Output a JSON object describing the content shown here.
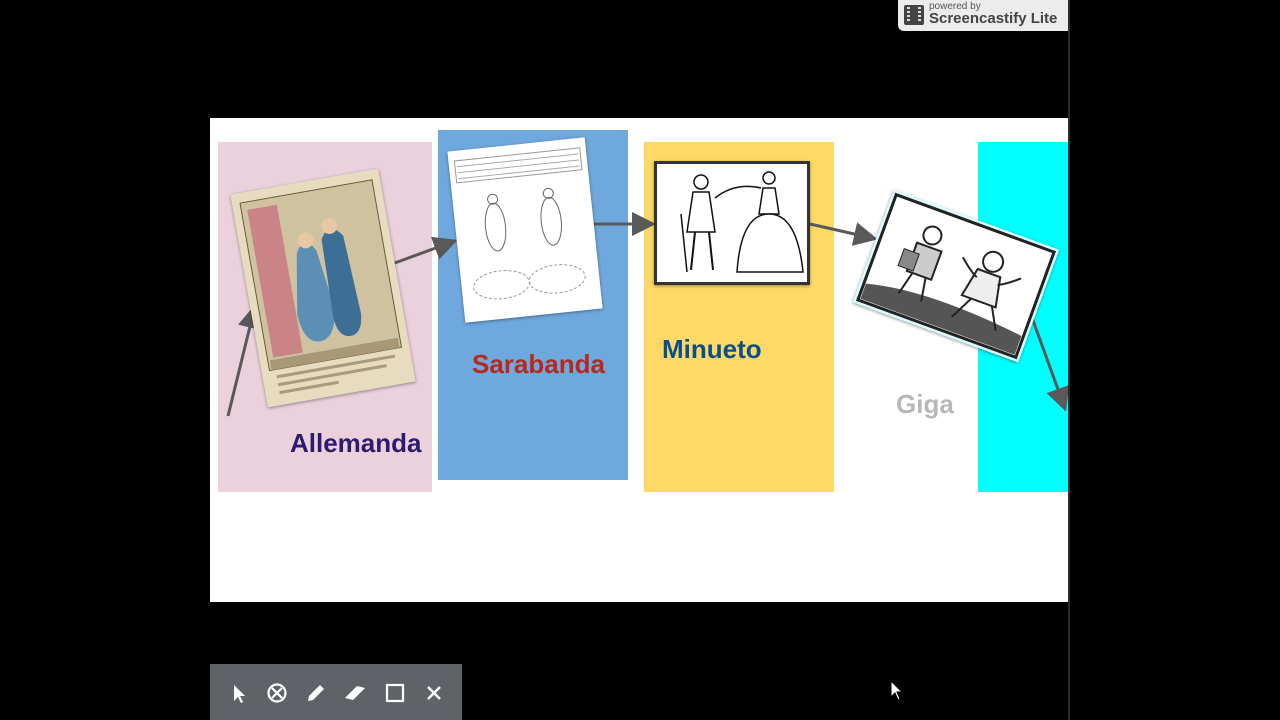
{
  "recorder": {
    "powered_by": "powered by",
    "name": "Screencastify Lite"
  },
  "slide": {
    "dances": [
      {
        "name": "Allemanda",
        "color": "#2e1a6e",
        "panel_color": "#ead1dc"
      },
      {
        "name": "Sarabanda",
        "color": "#b52a1c",
        "panel_color": "#6fa8dc"
      },
      {
        "name": "Minueto",
        "color": "#0b4f8a",
        "panel_color": "#ffd966"
      },
      {
        "name": "Giga",
        "color": "#b7b7b7",
        "panel_color": "#ffffff"
      },
      {
        "name": "",
        "color": "",
        "panel_color": "#00ffff"
      }
    ]
  },
  "toolbar": {
    "tools": [
      {
        "name": "pointer-icon"
      },
      {
        "name": "focus-icon"
      },
      {
        "name": "pen-icon"
      },
      {
        "name": "eraser-icon"
      },
      {
        "name": "rectangle-icon"
      },
      {
        "name": "close-icon"
      }
    ]
  }
}
